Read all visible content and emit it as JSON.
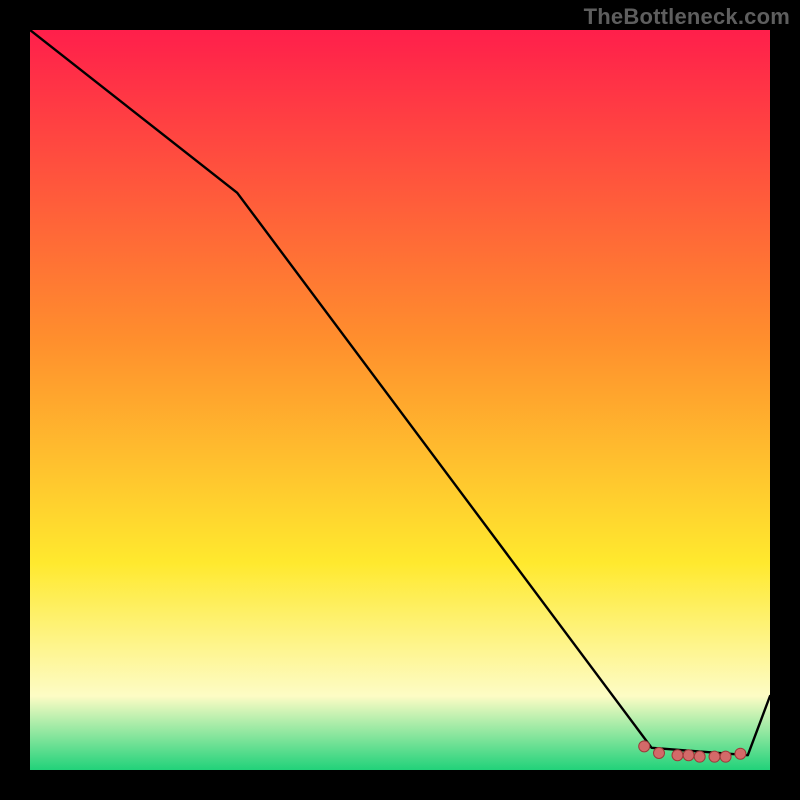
{
  "watermark": "TheBottleneck.com",
  "colors": {
    "top": "#ff1f4b",
    "mid1": "#ff8f2d",
    "mid2": "#ffe92e",
    "mid3": "#fdfcc5",
    "bottom": "#21d27a",
    "line": "#000000",
    "marker_fill": "#d36a69",
    "marker_stroke": "#9c3a3a"
  },
  "chart_data": {
    "type": "line",
    "title": "",
    "xlabel": "",
    "ylabel": "",
    "xlim": [
      0,
      100
    ],
    "ylim": [
      0,
      100
    ],
    "grid": false,
    "legend": false,
    "note": "Values are read off the plotted curve; axes are unlabeled so x and y are on relative 0–100 scales.",
    "series": [
      {
        "name": "curve",
        "x": [
          0,
          28,
          84,
          97,
          100
        ],
        "y": [
          100,
          78,
          3,
          2,
          10
        ]
      },
      {
        "name": "markers",
        "x": [
          83,
          85,
          87.5,
          89,
          90.5,
          92.5,
          94,
          96
        ],
        "y": [
          3.2,
          2.3,
          2.0,
          2.0,
          1.8,
          1.8,
          1.8,
          2.2
        ]
      }
    ]
  }
}
